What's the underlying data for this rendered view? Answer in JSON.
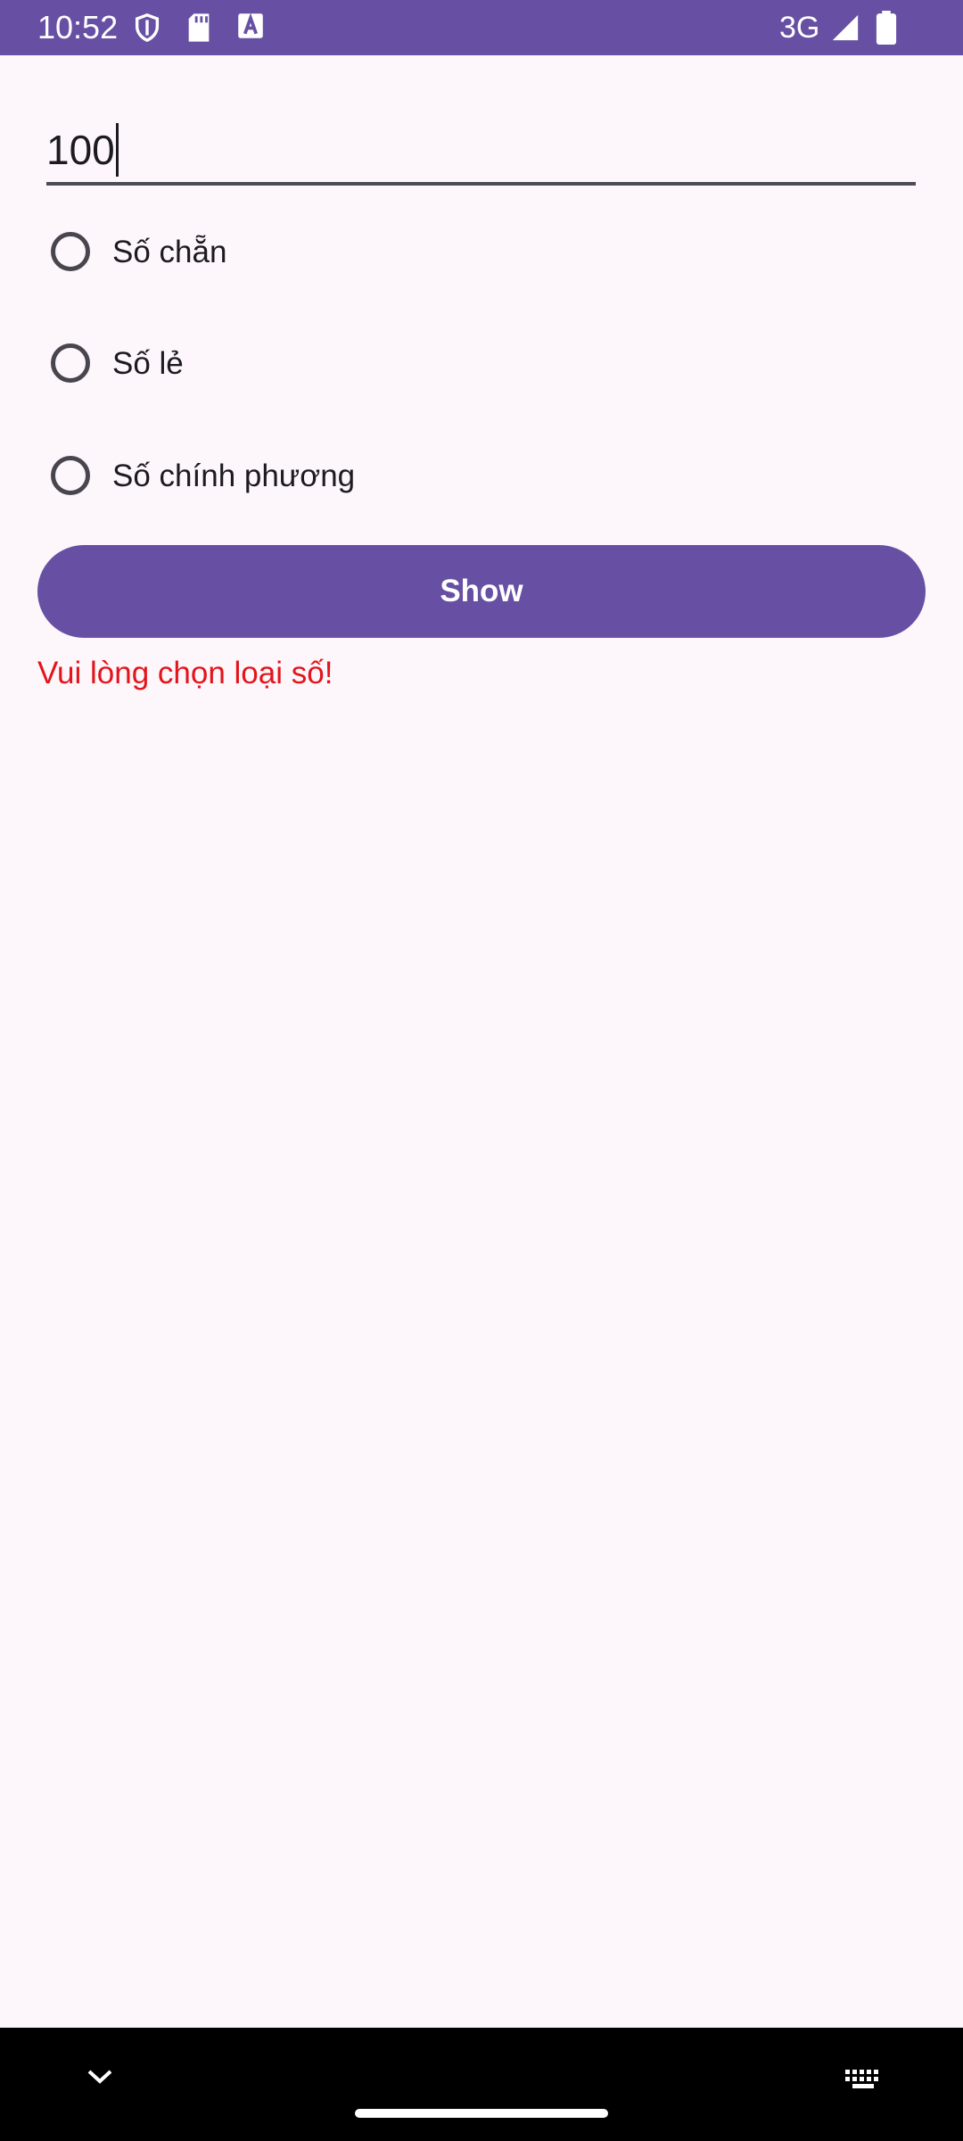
{
  "status_bar": {
    "time": "10:52",
    "network": "3G",
    "icons": [
      "shield-icon",
      "sd-card-icon",
      "text-a-icon",
      "signal-icon",
      "battery-icon"
    ],
    "background": "#6750a4"
  },
  "form": {
    "number_value": "100",
    "radio_options": [
      {
        "label": "Số chẵn",
        "checked": false
      },
      {
        "label": "Số lẻ",
        "checked": false
      },
      {
        "label": "Số chính phương",
        "checked": false
      }
    ],
    "show_button_label": "Show",
    "error_message": "Vui lòng chọn loại số!",
    "accent_color": "#6750a4",
    "error_color": "#e3141a"
  },
  "nav_bar": {
    "icons": [
      "chevron-down-icon",
      "keyboard-icon"
    ]
  }
}
